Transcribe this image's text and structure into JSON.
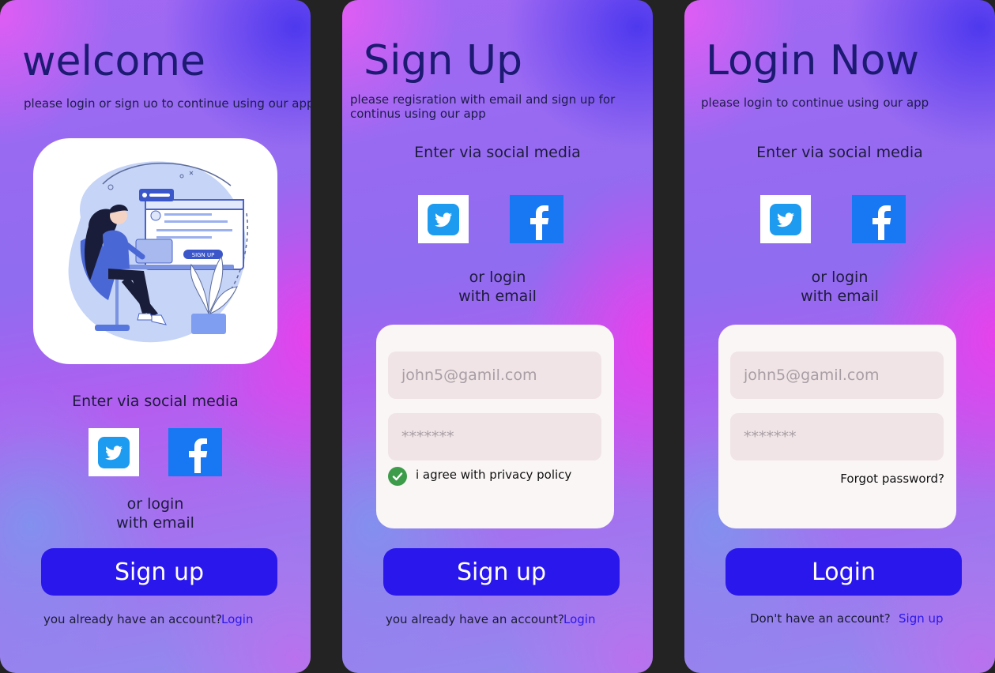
{
  "welcome_screen": {
    "title": "welcome",
    "subtitle": "please login or sign uo to continue using our app",
    "social_heading": "Enter via social media",
    "or_text": "or login\nwith email",
    "signup_button": "Sign up",
    "footer_text": "you already have an account?",
    "footer_link": "Login",
    "illustration_sign_up_label": "SIGN UP"
  },
  "signup_screen": {
    "title": "Sign Up",
    "subtitle": "please regisration with email and sign up for continus using our app",
    "social_heading": "Enter via social media",
    "or_text": "or login\nwith email",
    "email_placeholder": "john5@gamil.com",
    "password_placeholder": "*******",
    "privacy_label": "i agree with privacy policy",
    "privacy_checked": true,
    "signup_button": "Sign up",
    "footer_text": "you already have an account?",
    "footer_link": "Login"
  },
  "login_screen": {
    "title": "Login Now",
    "subtitle": "please login to continue using our app",
    "social_heading": "Enter via social media",
    "or_text": "or login\nwith email",
    "email_placeholder": "john5@gamil.com",
    "password_placeholder": "*******",
    "forgot_password": "Forgot password?",
    "login_button": "Login",
    "footer_text": "Don't have an account?",
    "footer_link": "Sign up"
  },
  "icons": {
    "twitter": "twitter-icon",
    "facebook": "facebook-icon",
    "check": "check-icon"
  },
  "colors": {
    "accent": "#2a17ec",
    "title": "#1c1a72",
    "twitter": "#1d9bf0",
    "facebook": "#1877f2",
    "check": "#3d9c4a",
    "app_background": "#232323"
  }
}
